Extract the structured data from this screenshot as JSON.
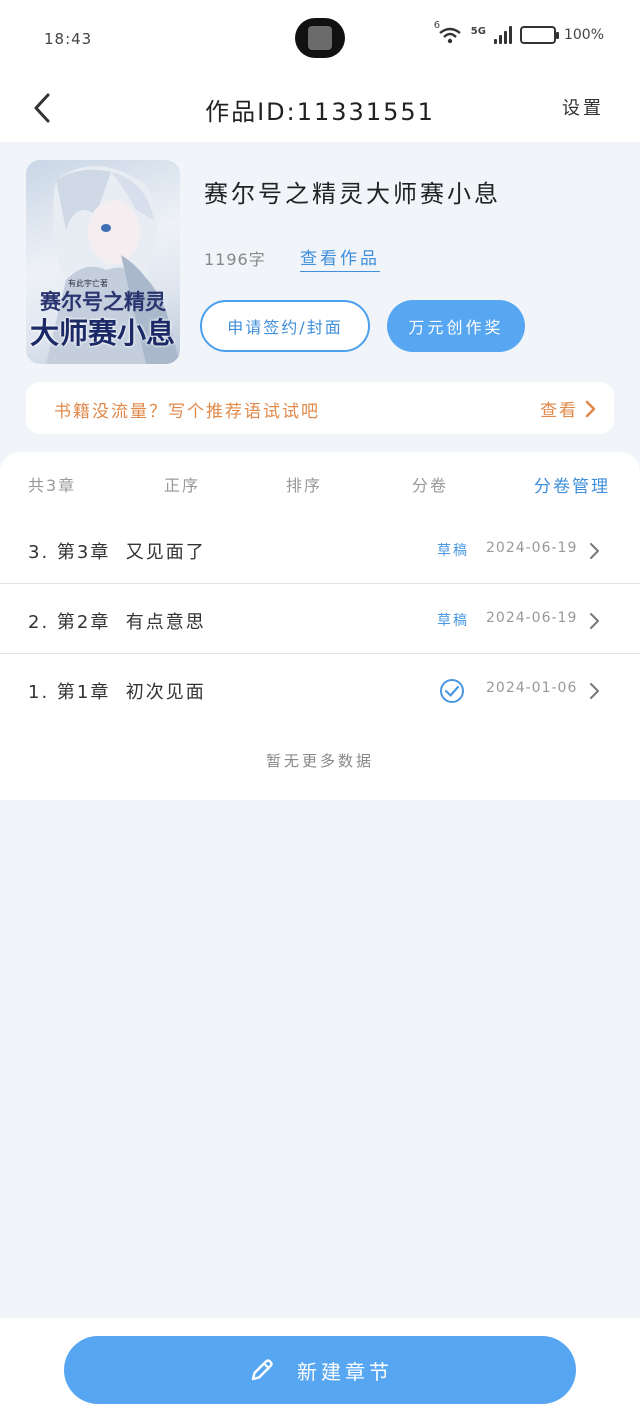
{
  "status_bar": {
    "time": "18:43",
    "network": "5G",
    "wifi_badge": "6",
    "battery": "100%"
  },
  "header": {
    "title": "作品ID:11331551",
    "settings_label": "设置"
  },
  "book": {
    "cover": {
      "author_tag": "有此宇亡著",
      "title_line1": "赛尔号之精灵",
      "title_line2": "大师赛小息"
    },
    "title": "赛尔号之精灵大师赛小息",
    "word_count": "1196字",
    "view_work_label": "查看作品",
    "apply_button_label": "申请签约/封面",
    "award_button_label": "万元创作奖"
  },
  "promo": {
    "text": "书籍没流量？写个推荐语试试吧",
    "view_label": "查看",
    "color": "#e0894a"
  },
  "toolbar": {
    "chapter_count": "共3章",
    "order_label": "正序",
    "sort_label": "排序",
    "volume_label": "分卷",
    "manage_label": "分卷管理"
  },
  "chapters": [
    {
      "title": "3. 第3章  又见面了",
      "status": "草稿",
      "published": false,
      "date": "2024-06-19"
    },
    {
      "title": "2. 第2章  有点意思",
      "status": "草稿",
      "published": false,
      "date": "2024-06-19"
    },
    {
      "title": "1. 第1章  初次见面",
      "status": "",
      "published": true,
      "date": "2024-01-06"
    }
  ],
  "list_footer": "暂无更多数据",
  "bottom": {
    "new_chapter_label": "新建章节"
  },
  "colors": {
    "accent": "#56a6f2",
    "link": "#3f8fdc",
    "background": "#f1f5f9"
  }
}
